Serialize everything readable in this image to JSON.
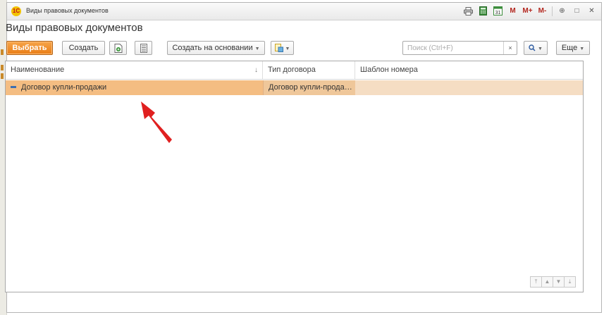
{
  "window": {
    "title": "Виды правовых документов",
    "logo": "1С",
    "tools": {
      "print_icon": "printer-icon",
      "calculator_icon": "calculator-icon",
      "calendar_icon": "calendar-icon",
      "calendar_day": "31",
      "m": "M",
      "m_plus": "M+",
      "m_minus": "M-",
      "zoom_icon": "⊕",
      "maximize_icon": "□",
      "close_icon": "✕"
    }
  },
  "form": {
    "title": "Виды правовых документов"
  },
  "toolbar": {
    "select_label": "Выбрать",
    "create_label": "Создать",
    "create_based_label": "Создать на основании",
    "more_label": "Еще",
    "search_placeholder": "Поиск (Ctrl+F)",
    "search_value": "",
    "search_clear": "×"
  },
  "grid": {
    "columns": [
      "Наименование",
      "Тип договора",
      "Шаблон номера"
    ],
    "sort_indicator": "↓",
    "rows": [
      {
        "name": "Договор купли-продажи",
        "contract_type": "Договор купли-прода…",
        "number_template": ""
      }
    ]
  },
  "nav": {
    "first": "⤒",
    "up": "▲",
    "down": "▼",
    "last": "⤓"
  },
  "colors": {
    "accent": "#e97d16",
    "selected_row": "#f4bd82",
    "row_highlight": "#f5ddc3",
    "annotation_arrow": "#e02020"
  }
}
